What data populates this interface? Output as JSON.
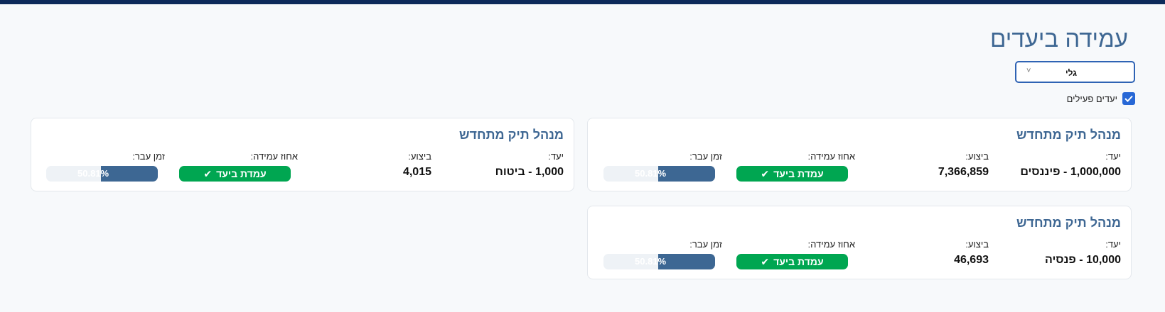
{
  "header": {
    "title": "עמידה ביעדים"
  },
  "filter_select": {
    "selected": "גלי"
  },
  "active_filter": {
    "label": "יעדים פעילים",
    "checked": true
  },
  "labels": {
    "goal": "יעד:",
    "performance": "ביצוע:",
    "achievement": "אחוז עמידה:",
    "time_elapsed": "זמן עבר:"
  },
  "cards": [
    {
      "title": "מנהל תיק מתחדש",
      "goal": "1,000,000 - פיננסים",
      "performance": "7,366,859",
      "status": "עמדת ביעד",
      "time_elapsed_pct": "50.81%",
      "time_elapsed_fraction": 0.5081
    },
    {
      "title": "מנהל תיק מתחדש",
      "goal": "1,000 - ביטוח",
      "performance": "4,015",
      "status": "עמדת ביעד",
      "time_elapsed_pct": "50.81%",
      "time_elapsed_fraction": 0.5081
    },
    {
      "title": "מנהל תיק מתחדש",
      "goal": "10,000 - פנסיה",
      "performance": "46,693",
      "status": "עמדת ביעד",
      "time_elapsed_pct": "50.81%",
      "time_elapsed_fraction": 0.5081
    }
  ],
  "colors": {
    "accent": "#3e6793",
    "success": "#00a651",
    "topbar": "#0d2a5a",
    "checkbox": "#2868d6"
  }
}
